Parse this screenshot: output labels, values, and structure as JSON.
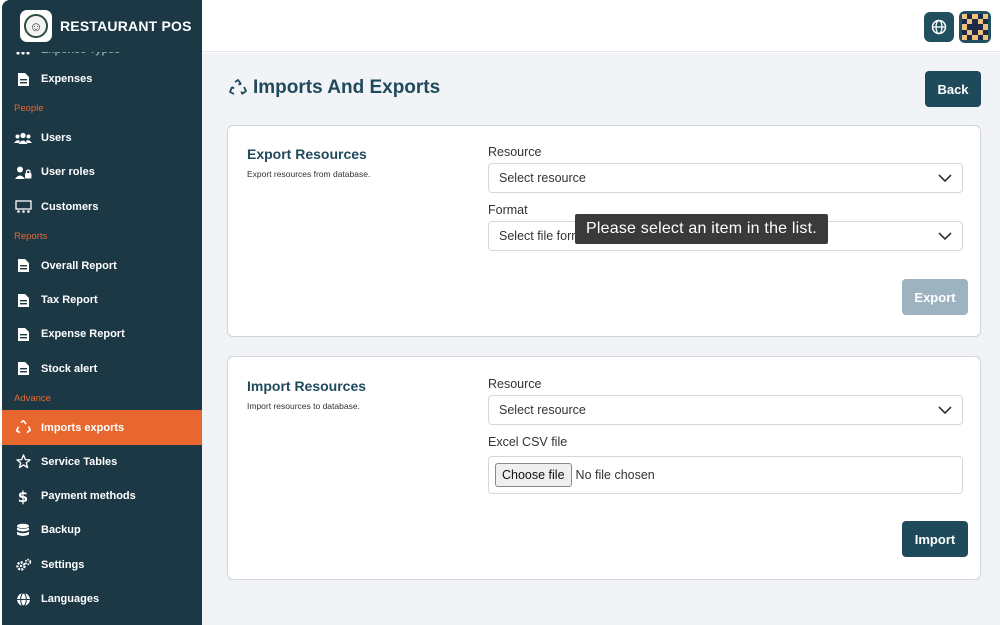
{
  "brand": {
    "name": "RESTAURANT POS",
    "logo_icon": "chef-logo"
  },
  "sidebar": {
    "cut_item": "Expense Types",
    "items": [
      {
        "type": "item",
        "label": "Expenses",
        "icon": "document-icon"
      },
      {
        "type": "section",
        "label": "People"
      },
      {
        "type": "item",
        "label": "Users",
        "icon": "users-icon"
      },
      {
        "type": "item",
        "label": "User roles",
        "icon": "user-lock-icon"
      },
      {
        "type": "item",
        "label": "Customers",
        "icon": "customers-icon"
      },
      {
        "type": "section",
        "label": "Reports"
      },
      {
        "type": "item",
        "label": "Overall Report",
        "icon": "document-icon"
      },
      {
        "type": "item",
        "label": "Tax Report",
        "icon": "document-icon"
      },
      {
        "type": "item",
        "label": "Expense Report",
        "icon": "document-icon"
      },
      {
        "type": "item",
        "label": "Stock alert",
        "icon": "document-icon"
      },
      {
        "type": "section",
        "label": "Advance"
      },
      {
        "type": "item",
        "label": "Imports exports",
        "icon": "recycle-icon",
        "active": true
      },
      {
        "type": "item",
        "label": "Service Tables",
        "icon": "star-icon"
      },
      {
        "type": "item",
        "label": "Payment methods",
        "icon": "dollar-icon"
      },
      {
        "type": "item",
        "label": "Backup",
        "icon": "database-icon"
      },
      {
        "type": "item",
        "label": "Settings",
        "icon": "gears-icon"
      },
      {
        "type": "item",
        "label": "Languages",
        "icon": "globe-icon"
      }
    ]
  },
  "topbar": {
    "language_icon": "globe-icon",
    "avatar_icon": "pixel-avatar-icon"
  },
  "page": {
    "title": "Imports And Exports",
    "title_icon": "recycle-icon",
    "back_label": "Back"
  },
  "export": {
    "title": "Export Resources",
    "subtitle": "Export resources from database.",
    "resource_label": "Resource",
    "resource_value": "Select resource",
    "format_label": "Format",
    "format_value": "Select file format",
    "button_label": "Export"
  },
  "import": {
    "title": "Import Resources",
    "subtitle": "Import resources to database.",
    "resource_label": "Resource",
    "resource_value": "Select resource",
    "file_label": "Excel CSV file",
    "file_button": "Choose file",
    "file_status": "No file chosen",
    "button_label": "Import"
  },
  "tooltip": {
    "text": "Please select an item in the list."
  },
  "colors": {
    "sidebar": "#1c3845",
    "accent": "#e8672f",
    "primary": "#1f4a5c",
    "disabled": "#9db3bf"
  }
}
